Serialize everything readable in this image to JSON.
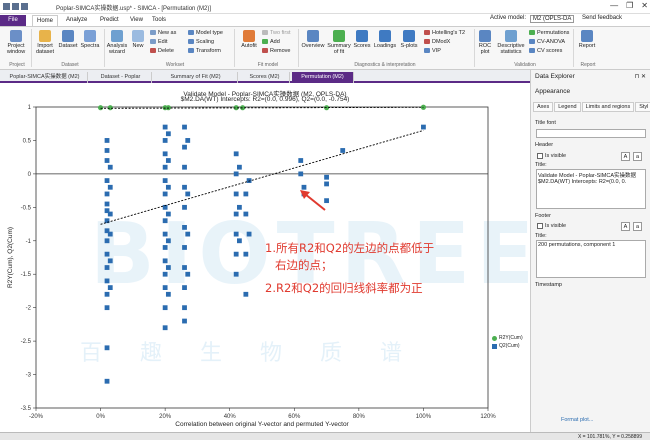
{
  "titlebar": {
    "title": "Poplar-SIMCA实操数据.usp* - SIMCA - [Permutation (M2)]",
    "minimize": "—",
    "maximize": "❐",
    "close": "✕"
  },
  "tabs": [
    "File",
    "Home",
    "Analyze",
    "Predict",
    "View",
    "Tools"
  ],
  "topright": {
    "active_model_label": "Active model:",
    "active_model": "M2 (OPLS-DA",
    "send_feedback": "Send feedback"
  },
  "ribbon": {
    "project_window": "Project window",
    "import_dataset": "Import dataset",
    "dataset": "Dataset",
    "spectra": "Spectra",
    "analysis_wizard": "Analysis wizard",
    "new": "New",
    "new_as": "New as",
    "edit": "Edit",
    "delete": "Delete",
    "model_type": "Model type",
    "scaling": "Scaling",
    "transform": "Transform",
    "autofit": "Autofit",
    "two_first": "Two first",
    "add": "Add",
    "remove": "Remove",
    "overview": "Overview",
    "summary_of_fit": "Summary of fit",
    "scores": "Scores",
    "loadings": "Loadings",
    "s_plots": "S-plots",
    "hotellings": "Hotelling's T2",
    "dmod": "DModX",
    "vip": "VIP",
    "roc_plot": "ROC plot",
    "descriptive_statistics": "Descriptive statistics",
    "permutations": "Permutations",
    "cv_anova": "CV-ANOVA",
    "cv_scores": "CV scores",
    "report": "Report",
    "groups": [
      "Project",
      "Dataset",
      "Workset",
      "Fit model",
      "Diagnostics & interpretation",
      "Validation",
      "Report"
    ]
  },
  "doctabs": [
    "Poplar-SIMCA实操数据 (M2)",
    "Dataset - Poplar",
    "Summary of Fit (M2)",
    "Scores (M2)",
    "Permutation (M2)"
  ],
  "plot": {
    "title": "Validate Model - Poplar-SIMCA实操数据 (M2, OPLS-DA)",
    "subtitle": "$M2.DA(WT) Intercepts: R2=(0.0, 0.996), Q2=(0.0, -0.754)"
  },
  "chart_data": {
    "type": "scatter",
    "xlabel": "Correlation between original Y-vector and permuted Y-vector",
    "ylabel": "R2Y(Cum), Q2(Cum)",
    "xlim": [
      -20,
      120
    ],
    "ylim": [
      -3.5,
      1.0
    ],
    "xticks": [
      "-20%",
      "0%",
      "20%",
      "40%",
      "60%",
      "80%",
      "100%",
      "120%"
    ],
    "yticks": [
      "1",
      "0.5",
      "0",
      "-0.5",
      "-1",
      "-1.5",
      "-2",
      "-2.5",
      "-3",
      "-3.5"
    ],
    "series": [
      {
        "name": "R2Y(Cum)",
        "color": "#4caf50",
        "points": [
          [
            0,
            0.99
          ],
          [
            3,
            0.99
          ],
          [
            20,
            0.99
          ],
          [
            21,
            0.99
          ],
          [
            42,
            0.99
          ],
          [
            44,
            0.99
          ],
          [
            70,
            0.99
          ],
          [
            100,
            0.996
          ]
        ]
      },
      {
        "name": "Q2(Cum)",
        "color": "#2b6cb0",
        "points": [
          [
            2,
            0.5
          ],
          [
            2,
            0.35
          ],
          [
            2,
            0.2
          ],
          [
            2,
            -0.1
          ],
          [
            2,
            -0.3
          ],
          [
            2,
            -0.45
          ],
          [
            2,
            -0.55
          ],
          [
            2,
            -0.7
          ],
          [
            2,
            -0.85
          ],
          [
            2,
            -1.0
          ],
          [
            2,
            -1.2
          ],
          [
            2,
            -1.4
          ],
          [
            2,
            -1.6
          ],
          [
            2,
            -1.8
          ],
          [
            2,
            -2.0
          ],
          [
            2,
            -2.6
          ],
          [
            2,
            -3.1
          ],
          [
            3,
            0.1
          ],
          [
            3,
            -0.2
          ],
          [
            3,
            -0.6
          ],
          [
            3,
            -0.9
          ],
          [
            3,
            -1.3
          ],
          [
            3,
            -1.7
          ],
          [
            20,
            0.7
          ],
          [
            20,
            0.5
          ],
          [
            20,
            0.3
          ],
          [
            20,
            0.1
          ],
          [
            20,
            -0.1
          ],
          [
            20,
            -0.3
          ],
          [
            20,
            -0.5
          ],
          [
            20,
            -0.7
          ],
          [
            20,
            -0.9
          ],
          [
            20,
            -1.1
          ],
          [
            20,
            -1.3
          ],
          [
            20,
            -1.5
          ],
          [
            20,
            -1.7
          ],
          [
            20,
            -2.0
          ],
          [
            20,
            -2.3
          ],
          [
            21,
            0.6
          ],
          [
            21,
            0.2
          ],
          [
            21,
            -0.2
          ],
          [
            21,
            -0.6
          ],
          [
            21,
            -1.0
          ],
          [
            21,
            -1.4
          ],
          [
            21,
            -1.8
          ],
          [
            26,
            0.7
          ],
          [
            26,
            0.4
          ],
          [
            26,
            0.1
          ],
          [
            26,
            -0.2
          ],
          [
            26,
            -0.5
          ],
          [
            26,
            -0.8
          ],
          [
            26,
            -1.1
          ],
          [
            26,
            -1.4
          ],
          [
            26,
            -1.7
          ],
          [
            26,
            -2.0
          ],
          [
            26,
            -2.2
          ],
          [
            27,
            0.5
          ],
          [
            27,
            -0.3
          ],
          [
            27,
            -0.9
          ],
          [
            27,
            -1.5
          ],
          [
            42,
            0.3
          ],
          [
            42,
            0.0
          ],
          [
            42,
            -0.3
          ],
          [
            42,
            -0.6
          ],
          [
            42,
            -0.9
          ],
          [
            42,
            -1.2
          ],
          [
            42,
            -1.5
          ],
          [
            43,
            0.1
          ],
          [
            43,
            -0.5
          ],
          [
            43,
            -1.0
          ],
          [
            45,
            -0.3
          ],
          [
            45,
            -0.6
          ],
          [
            45,
            -1.2
          ],
          [
            45,
            -1.8
          ],
          [
            46,
            -0.1
          ],
          [
            46,
            -0.9
          ],
          [
            62,
            0.2
          ],
          [
            62,
            0.0
          ],
          [
            63,
            -0.2
          ],
          [
            63,
            -0.3
          ],
          [
            70,
            -0.05
          ],
          [
            70,
            -0.15
          ],
          [
            70,
            -0.4
          ],
          [
            75,
            0.35
          ],
          [
            100,
            0.7
          ]
        ]
      },
      {
        "name": "R2 regression",
        "color": "#000000",
        "line": [
          [
            0,
            0.98
          ],
          [
            100,
            0.996
          ]
        ]
      },
      {
        "name": "Q2 regression",
        "color": "#000000",
        "line": [
          [
            0,
            -0.754
          ],
          [
            100,
            0.65
          ]
        ]
      }
    ]
  },
  "legend": [
    "R2Y(Cum)",
    "Q2(Cum)"
  ],
  "annotation": {
    "line1": "1.所有R2和Q2的左边的点都低于",
    "line2": "右边的点；",
    "line3": "2.R2和Q2的回归线斜率都为正"
  },
  "watermark": {
    "big": "BIOTREE",
    "small": "百趣生物质谱"
  },
  "explorer": {
    "title": "Data Explorer",
    "appearance": "Appearance",
    "tabs": [
      "Axes",
      "Legend",
      "Limits and regions",
      "Styl"
    ],
    "title_font": "Title font",
    "header": "Header",
    "is_visible": "Is visible",
    "title_label": "Title:",
    "header_text": "Validate Model - Poplar-SIMCA实操数据 $M2.DA(WT) Intercepts: R2=(0.0, 0.",
    "footer": "Footer",
    "footer_text": "200 permutations, component 1",
    "timestamp": "Timestamp",
    "format_plot": "Format plot..."
  },
  "status": {
    "coords": "X = 101.781%, Y = 0.258899"
  }
}
